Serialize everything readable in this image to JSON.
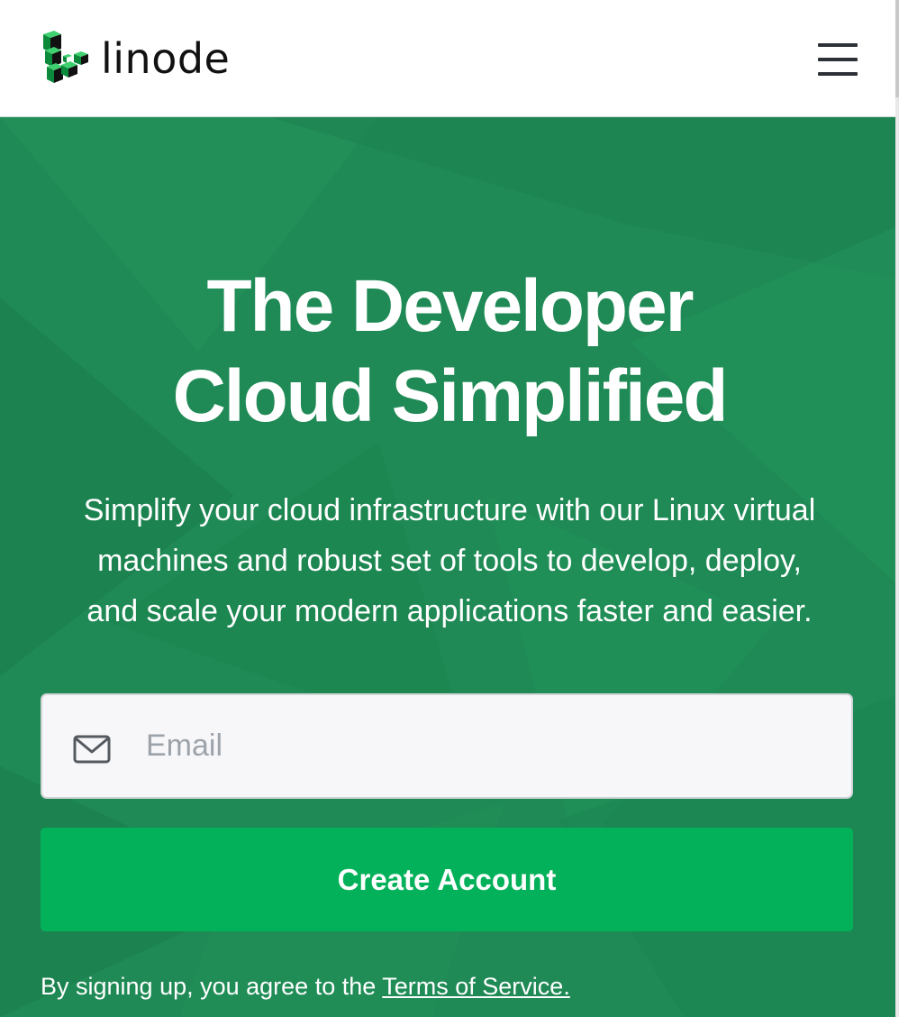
{
  "header": {
    "logo_text": "linode",
    "menu_icon": "hamburger-menu-icon",
    "logo_icon": "linode-cube-logo-icon"
  },
  "hero": {
    "title_line1": "The Developer",
    "title_line2": "Cloud Simplified",
    "subtitle_line1": "Simplify your cloud infrastructure with our Linux virtual",
    "subtitle_line2": "machines and robust set of tools to develop, deploy,",
    "subtitle_line3": "and scale your modern applications faster and easier.",
    "email": {
      "placeholder": "Email",
      "value": "",
      "icon": "envelope-icon"
    },
    "create_button_label": "Create Account",
    "terms_prefix": "By signing up, you agree to the ",
    "terms_link_label": "Terms of Service."
  },
  "colors": {
    "hero_background": "#1f8a55",
    "button_background": "#02b159",
    "logo_green": "#02b159",
    "text_dark": "#111111",
    "input_background": "#f7f7f9"
  }
}
